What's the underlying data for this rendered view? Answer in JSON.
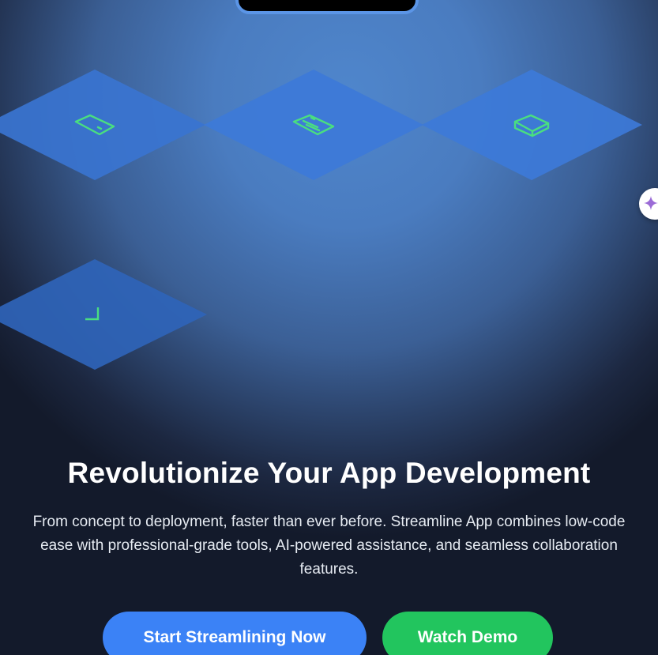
{
  "hero": {
    "title": "Revolutionize Your App Development",
    "subtitle": "From concept to deployment, faster than ever before. Streamline App combines low-code ease with professional-grade tools, AI-powered assistance, and seamless collaboration features.",
    "primary_cta": "Start Streamlining Now",
    "secondary_cta": "Watch Demo"
  },
  "tiles": [
    {
      "icon": "tablet-icon"
    },
    {
      "icon": "document-icon"
    },
    {
      "icon": "box-icon"
    },
    {
      "icon": "corner-bracket-icon"
    }
  ],
  "side_button": {
    "icon": "sparkle-icon"
  },
  "colors": {
    "background": "#131a2b",
    "glow": "#4f86cc",
    "tile": "#3d78d4",
    "icon_accent": "#4ade80",
    "primary_button": "#3b82f6",
    "secondary_button": "#22c55e",
    "sparkle": "#9b6bd6"
  }
}
